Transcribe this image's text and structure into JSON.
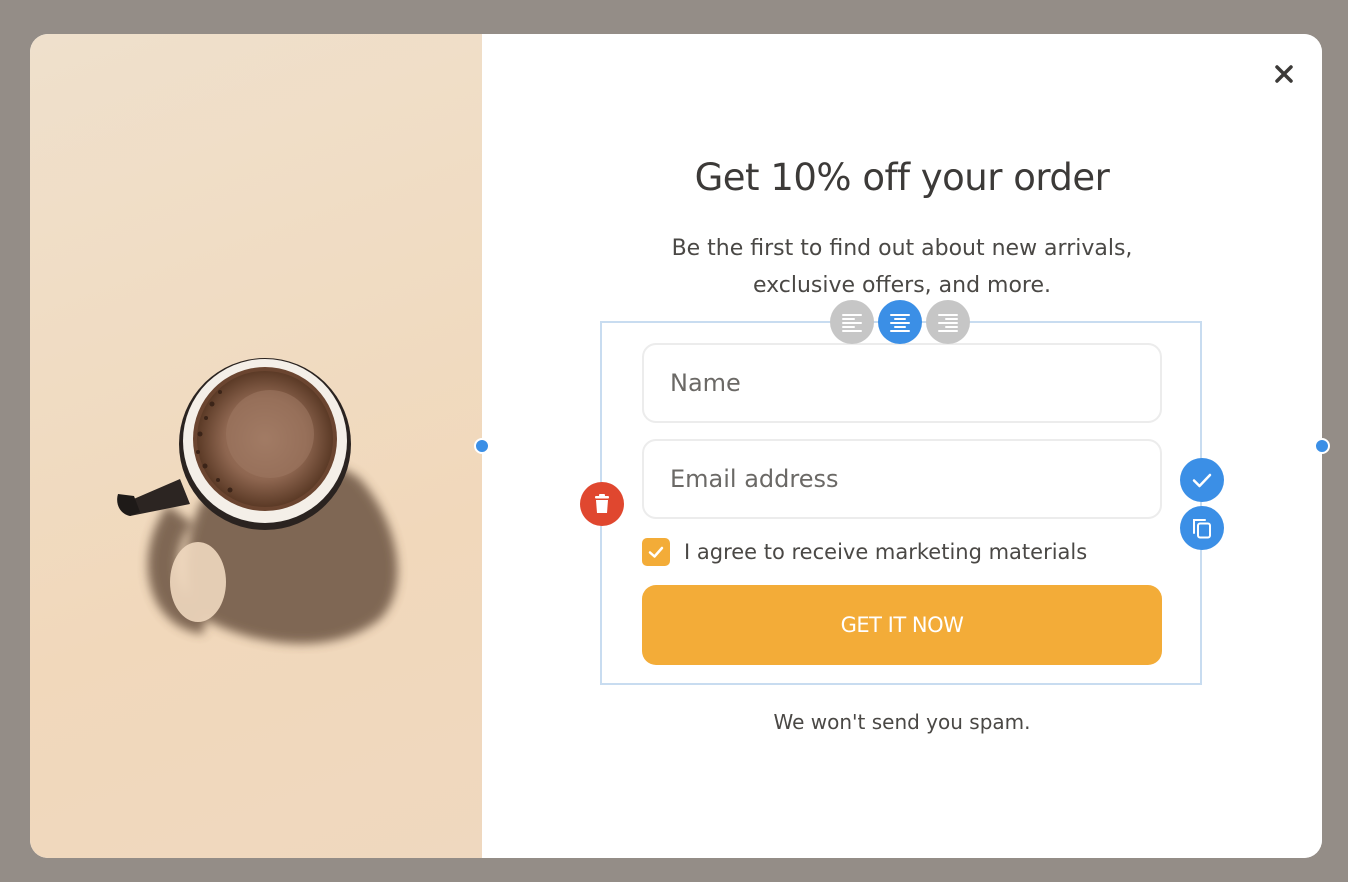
{
  "popup": {
    "title": "Get 10% off your order",
    "subtitle_line1": "Be the first to find out about new arrivals,",
    "subtitle_line2": "exclusive offers, and more.",
    "name_placeholder": "Name",
    "email_placeholder": "Email address",
    "consent_label": "I agree to receive marketing materials",
    "consent_checked": true,
    "cta_label": "GET IT NOW",
    "footnote": "We won't send you spam."
  },
  "editor": {
    "align_options": [
      "align-left",
      "align-center",
      "align-right"
    ],
    "align_selected": "align-center"
  },
  "icons": {
    "close": "close-icon",
    "delete": "trash-icon",
    "confirm": "check-icon",
    "duplicate": "copy-icon",
    "checkbox": "check-icon"
  },
  "colors": {
    "accent": "#f3ac38",
    "editor_blue": "#3b8fe6",
    "delete_red": "#e0472f",
    "overlay": "#948d87"
  }
}
